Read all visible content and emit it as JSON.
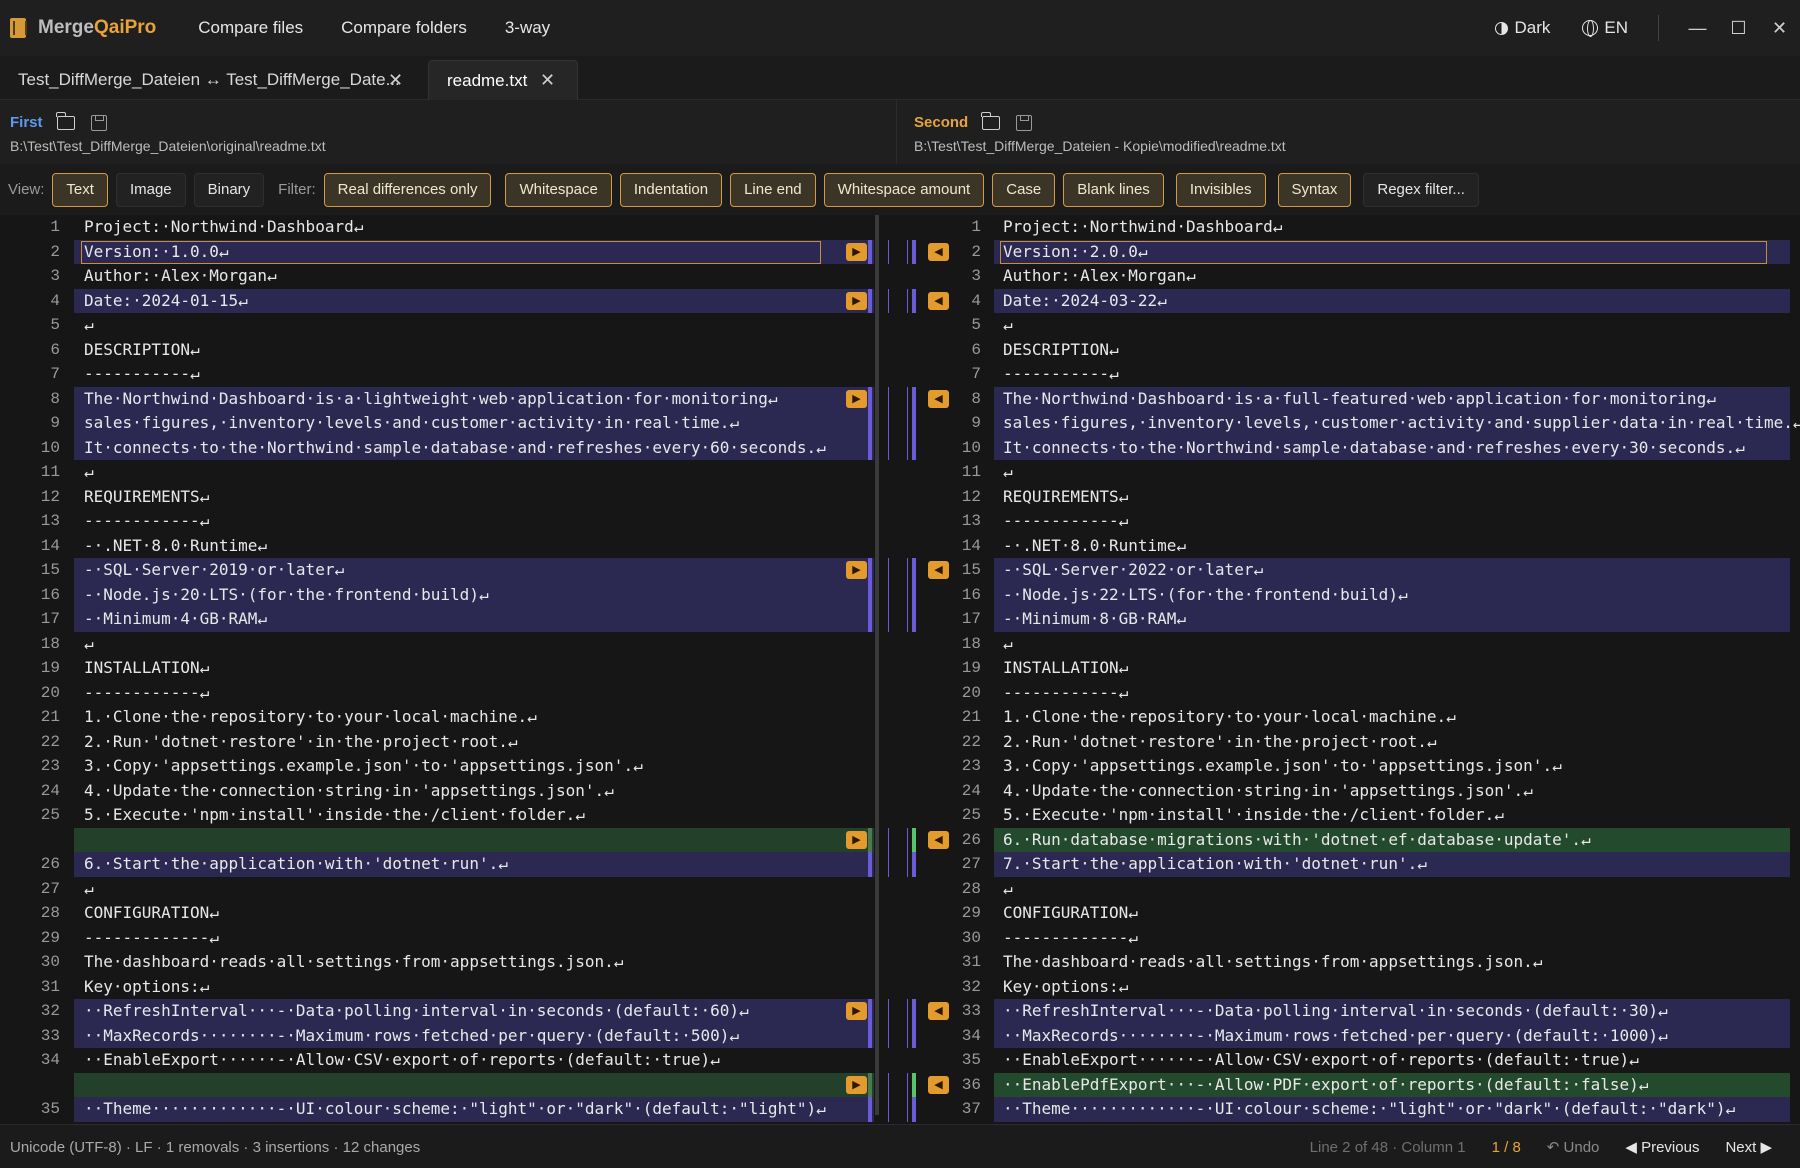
{
  "app": {
    "brand_prefix": "Merge",
    "brand_suffix": "QaiPro",
    "menu": [
      "Compare files",
      "Compare folders",
      "3-way"
    ],
    "theme_label": "Dark",
    "lang_label": "EN"
  },
  "tabs": [
    {
      "label": "Test_DiffMerge_Dateien ↔ Test_DiffMerge_Date..."
    },
    {
      "label": "readme.txt"
    }
  ],
  "files": {
    "left": {
      "label": "First",
      "path": "B:\\Test\\Test_DiffMerge_Dateien\\original\\readme.txt"
    },
    "right": {
      "label": "Second",
      "path": "B:\\Test\\Test_DiffMerge_Dateien - Kopie\\modified\\readme.txt"
    }
  },
  "view": {
    "label": "View:",
    "options": [
      "Text",
      "Image",
      "Binary"
    ],
    "active": "Text"
  },
  "filter": {
    "label": "Filter:",
    "options": [
      "Real differences only",
      "Whitespace",
      "Indentation",
      "Line end",
      "Whitespace amount",
      "Case",
      "Blank lines",
      "Invisibles",
      "Syntax",
      "Regex filter..."
    ],
    "active": [
      "Real differences only",
      "Whitespace",
      "Indentation",
      "Line end",
      "Whitespace amount",
      "Case",
      "Blank lines",
      "Invisibles",
      "Syntax"
    ]
  },
  "diff_rows": [
    {
      "l": 1,
      "lt": "Project:·Northwind·Dashboard↵",
      "r": 1,
      "rt": "Project:·Northwind·Dashboard↵",
      "k": ""
    },
    {
      "l": 2,
      "lt": "Version:·1.0.0↵",
      "r": 2,
      "rt": "Version:·2.0.0↵",
      "k": "c",
      "a": 1,
      "s": 1
    },
    {
      "l": 3,
      "lt": "Author:·Alex·Morgan↵",
      "r": 3,
      "rt": "Author:·Alex·Morgan↵",
      "k": ""
    },
    {
      "l": 4,
      "lt": "Date:·2024-01-15↵",
      "r": 4,
      "rt": "Date:·2024-03-22↵",
      "k": "c",
      "a": 1
    },
    {
      "l": 5,
      "lt": "↵",
      "r": 5,
      "rt": "↵",
      "k": ""
    },
    {
      "l": 6,
      "lt": "DESCRIPTION↵",
      "r": 6,
      "rt": "DESCRIPTION↵",
      "k": ""
    },
    {
      "l": 7,
      "lt": "-----------↵",
      "r": 7,
      "rt": "-----------↵",
      "k": ""
    },
    {
      "l": 8,
      "lt": "The·Northwind·Dashboard·is·a·lightweight·web·application·for·monitoring↵",
      "r": 8,
      "rt": "The·Northwind·Dashboard·is·a·full-featured·web·application·for·monitoring↵",
      "k": "c",
      "a": 1
    },
    {
      "l": 9,
      "lt": "sales·figures,·inventory·levels·and·customer·activity·in·real·time.↵",
      "r": 9,
      "rt": "sales·figures,·inventory·levels,·customer·activity·and·supplier·data·in·real·time.↵",
      "k": "c"
    },
    {
      "l": 10,
      "lt": "It·connects·to·the·Northwind·sample·database·and·refreshes·every·60·seconds.↵",
      "r": 10,
      "rt": "It·connects·to·the·Northwind·sample·database·and·refreshes·every·30·seconds.↵",
      "k": "c"
    },
    {
      "l": 11,
      "lt": "↵",
      "r": 11,
      "rt": "↵",
      "k": ""
    },
    {
      "l": 12,
      "lt": "REQUIREMENTS↵",
      "r": 12,
      "rt": "REQUIREMENTS↵",
      "k": ""
    },
    {
      "l": 13,
      "lt": "------------↵",
      "r": 13,
      "rt": "------------↵",
      "k": ""
    },
    {
      "l": 14,
      "lt": "-·.NET·8.0·Runtime↵",
      "r": 14,
      "rt": "-·.NET·8.0·Runtime↵",
      "k": ""
    },
    {
      "l": 15,
      "lt": "-·SQL·Server·2019·or·later↵",
      "r": 15,
      "rt": "-·SQL·Server·2022·or·later↵",
      "k": "c",
      "a": 1
    },
    {
      "l": 16,
      "lt": "-·Node.js·20·LTS·(for·the·frontend·build)↵",
      "r": 16,
      "rt": "-·Node.js·22·LTS·(for·the·frontend·build)↵",
      "k": "c"
    },
    {
      "l": 17,
      "lt": "-·Minimum·4·GB·RAM↵",
      "r": 17,
      "rt": "-·Minimum·8·GB·RAM↵",
      "k": "c"
    },
    {
      "l": 18,
      "lt": "↵",
      "r": 18,
      "rt": "↵",
      "k": ""
    },
    {
      "l": 19,
      "lt": "INSTALLATION↵",
      "r": 19,
      "rt": "INSTALLATION↵",
      "k": ""
    },
    {
      "l": 20,
      "lt": "------------↵",
      "r": 20,
      "rt": "------------↵",
      "k": ""
    },
    {
      "l": 21,
      "lt": "1.·Clone·the·repository·to·your·local·machine.↵",
      "r": 21,
      "rt": "1.·Clone·the·repository·to·your·local·machine.↵",
      "k": ""
    },
    {
      "l": 22,
      "lt": "2.·Run·'dotnet·restore'·in·the·project·root.↵",
      "r": 22,
      "rt": "2.·Run·'dotnet·restore'·in·the·project·root.↵",
      "k": ""
    },
    {
      "l": 23,
      "lt": "3.·Copy·'appsettings.example.json'·to·'appsettings.json'.↵",
      "r": 23,
      "rt": "3.·Copy·'appsettings.example.json'·to·'appsettings.json'.↵",
      "k": ""
    },
    {
      "l": 24,
      "lt": "4.·Update·the·connection·string·in·'appsettings.json'.↵",
      "r": 24,
      "rt": "4.·Update·the·connection·string·in·'appsettings.json'.↵",
      "k": ""
    },
    {
      "l": 25,
      "lt": "5.·Execute·'npm·install'·inside·the·/client·folder.↵",
      "r": 25,
      "rt": "5.·Execute·'npm·install'·inside·the·/client·folder.↵",
      "k": ""
    },
    {
      "l": "",
      "lt": "",
      "r": 26,
      "rt": "6.·Run·database·migrations·with·'dotnet·ef·database·update'.↵",
      "k": "i",
      "a": 1
    },
    {
      "l": 26,
      "lt": "6.·Start·the·application·with·'dotnet·run'.↵",
      "r": 27,
      "rt": "7.·Start·the·application·with·'dotnet·run'.↵",
      "k": "c"
    },
    {
      "l": 27,
      "lt": "↵",
      "r": 28,
      "rt": "↵",
      "k": ""
    },
    {
      "l": 28,
      "lt": "CONFIGURATION↵",
      "r": 29,
      "rt": "CONFIGURATION↵",
      "k": ""
    },
    {
      "l": 29,
      "lt": "-------------↵",
      "r": 30,
      "rt": "-------------↵",
      "k": ""
    },
    {
      "l": 30,
      "lt": "The·dashboard·reads·all·settings·from·appsettings.json.↵",
      "r": 31,
      "rt": "The·dashboard·reads·all·settings·from·appsettings.json.↵",
      "k": ""
    },
    {
      "l": 31,
      "lt": "Key·options:↵",
      "r": 32,
      "rt": "Key·options:↵",
      "k": ""
    },
    {
      "l": 32,
      "lt": "··RefreshInterval···-·Data·polling·interval·in·seconds·(default:·60)↵",
      "r": 33,
      "rt": "··RefreshInterval···-·Data·polling·interval·in·seconds·(default:·30)↵",
      "k": "c",
      "a": 1
    },
    {
      "l": 33,
      "lt": "··MaxRecords········-·Maximum·rows·fetched·per·query·(default:·500)↵",
      "r": 34,
      "rt": "··MaxRecords········-·Maximum·rows·fetched·per·query·(default:·1000)↵",
      "k": "c"
    },
    {
      "l": 34,
      "lt": "··EnableExport······-·Allow·CSV·export·of·reports·(default:·true)↵",
      "r": 35,
      "rt": "··EnableExport······-·Allow·CSV·export·of·reports·(default:·true)↵",
      "k": ""
    },
    {
      "l": "",
      "lt": "",
      "r": 36,
      "rt": "··EnablePdfExport···-·Allow·PDF·export·of·reports·(default:·false)↵",
      "k": "i",
      "a": 1
    },
    {
      "l": 35,
      "lt": "··Theme·············-·UI·colour·scheme:·\"light\"·or·\"dark\"·(default:·\"light\")↵",
      "r": 37,
      "rt": "··Theme·············-·UI·colour·scheme:·\"light\"·or·\"dark\"·(default:·\"dark\")↵",
      "k": "c"
    }
  ],
  "status": {
    "encoding": "Unicode (UTF-8)",
    "line_end": "LF",
    "removals": "1 removals",
    "insertions": "3 insertions",
    "changes": "12 changes",
    "position": "Line 2 of 48 · Column 1",
    "diff_index": "1 / 8",
    "undo": "↶ Undo",
    "previous": "◀ Previous",
    "next": "Next ▶"
  },
  "colors": {
    "accent": "#e39b2d",
    "changed_bg": "#2b2852",
    "inserted_bg": "#1f3a24",
    "left_label": "#5b9cf0",
    "right_label": "#e8a33a"
  }
}
